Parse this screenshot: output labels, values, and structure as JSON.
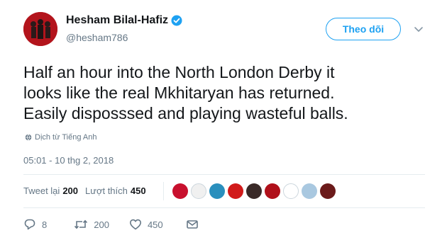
{
  "user": {
    "display_name": "Hesham Bilal-Hafiz",
    "handle": "@hesham786"
  },
  "follow_label": "Theo dõi",
  "tweet": {
    "lines": [
      "Half an hour into the North London Derby it",
      "looks like the real Mkhitaryan has returned.",
      "Easily disposssed and playing wasteful balls."
    ],
    "translate_label": "Dịch từ Tiếng Anh",
    "timestamp": "05:01 - 10 thg 2, 2018"
  },
  "stats": {
    "retweets_label": "Tweet lại",
    "retweets_count": "200",
    "likes_label": "Lượt thích",
    "likes_count": "450"
  },
  "likers": [
    "#c8102e",
    "#f0f0f0",
    "#2a8fbd",
    "#d11a1a",
    "#3a2a28",
    "#b0101a",
    "#ffffff",
    "#a9c8e0",
    "#6b1a1a"
  ],
  "actions": {
    "reply_count": "8",
    "retweet_count": "200",
    "like_count": "450"
  },
  "colors": {
    "accent": "#1da1f2",
    "text": "#14171a",
    "muted": "#657786",
    "divider": "#e6ecf0"
  }
}
